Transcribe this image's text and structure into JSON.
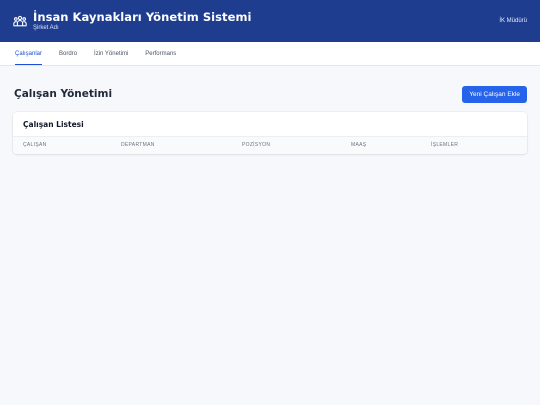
{
  "header": {
    "title": "İnsan Kaynakları Yönetim Sistemi",
    "company": "Şirket Adı",
    "user_role": "İK Müdürü",
    "icon": "people-group-icon"
  },
  "nav": {
    "tabs": [
      {
        "label": "Çalışanlar",
        "active": true
      },
      {
        "label": "Bordro",
        "active": false
      },
      {
        "label": "İzin Yönetimi",
        "active": false
      },
      {
        "label": "Performans",
        "active": false
      }
    ]
  },
  "main": {
    "title": "Çalışan Yönetimi",
    "add_button": "Yeni Çalışan Ekle",
    "card": {
      "title": "Çalışan Listesi",
      "columns": [
        "ÇALIŞAN",
        "DEPARTMAN",
        "POZİSYON",
        "MAAŞ",
        "İŞLEMLER"
      ]
    }
  },
  "colors": {
    "header_bg": "#1e3d8f",
    "accent": "#2563eb",
    "page_bg": "#f7f8fb"
  }
}
